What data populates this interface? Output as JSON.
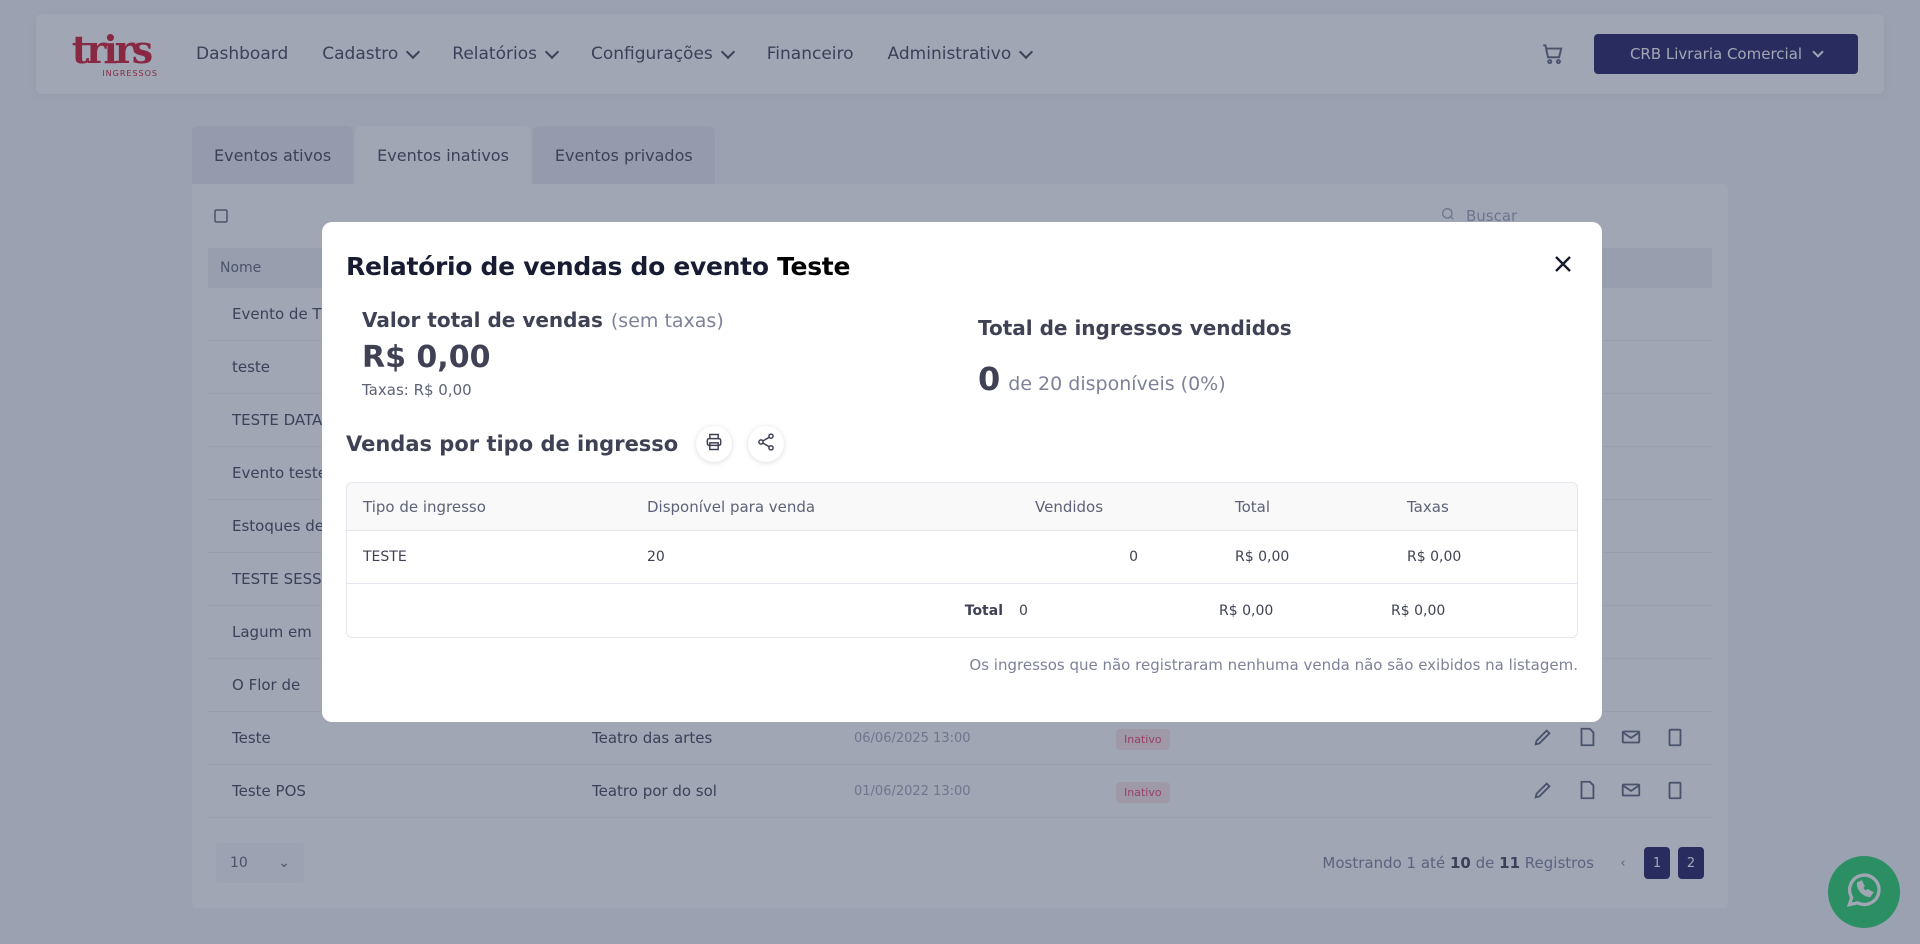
{
  "header": {
    "logo_main": "trirs",
    "logo_sub": "INGRESSOS",
    "nav": [
      {
        "label": "Dashboard",
        "dropdown": false
      },
      {
        "label": "Cadastro",
        "dropdown": true
      },
      {
        "label": "Relatórios",
        "dropdown": true
      },
      {
        "label": "Configurações",
        "dropdown": true
      },
      {
        "label": "Financeiro",
        "dropdown": false
      },
      {
        "label": "Administrativo",
        "dropdown": true
      }
    ],
    "user_label": "CRB Livraria Comercial"
  },
  "tabs": [
    "Eventos ativos",
    "Eventos inativos",
    "Eventos privados"
  ],
  "list": {
    "search_placeholder": "Buscar",
    "column_name": "Nome",
    "rows": [
      {
        "name": "Evento de T",
        "venue": "",
        "date": "",
        "status": ""
      },
      {
        "name": "teste",
        "venue": "",
        "date": "",
        "status": ""
      },
      {
        "name": "TESTE DATAS",
        "venue": "",
        "date": "",
        "status": ""
      },
      {
        "name": "Evento teste",
        "venue": "",
        "date": "",
        "status": ""
      },
      {
        "name": "Estoques de",
        "venue": "",
        "date": "",
        "status": ""
      },
      {
        "name": "TESTE SESSÃO",
        "venue": "",
        "date": "",
        "status": ""
      },
      {
        "name": "Lagum em",
        "venue": "",
        "date": "",
        "status": ""
      },
      {
        "name": "O Flor de",
        "venue": "",
        "date": "",
        "status": ""
      },
      {
        "name": "Teste",
        "venue": "Teatro das artes",
        "date": "06/06/2025 13:00",
        "status": "Inativo"
      },
      {
        "name": "Teste POS",
        "venue": "Teatro por do sol",
        "date": "01/06/2022 13:00",
        "status": "Inativo"
      }
    ],
    "page_size": "10",
    "page_info_prefix": "Mostrando 1 até",
    "page_info_to": "10",
    "page_info_of": "de",
    "page_info_total": "11",
    "page_info_suffix": "Registros",
    "pages": [
      "‹",
      "1",
      "2"
    ]
  },
  "modal": {
    "title_prefix": "Relatório de vendas do evento",
    "event_name": "Teste",
    "total_sales_label": "Valor total de vendas",
    "total_sales_note": "(sem taxas)",
    "total_sales_value": "R$ 0,00",
    "fees_label": "Taxas: R$ 0,00",
    "tickets_sold_label": "Total de ingressos vendidos",
    "tickets_sold_value": "0",
    "tickets_available_text": "de 20 disponíveis (0%)",
    "section_title": "Vendas por tipo de ingresso",
    "table": {
      "headers": [
        "Tipo de ingresso",
        "Disponível para venda",
        "Vendidos",
        "Total",
        "Taxas"
      ],
      "rows": [
        {
          "type": "TESTE",
          "available": "20",
          "sold": "0",
          "total": "R$ 0,00",
          "fees": "R$ 0,00"
        }
      ],
      "footer": {
        "label": "Total",
        "sold": "0",
        "total": "R$ 0,00",
        "fees": "R$ 0,00"
      }
    },
    "note": "Os ingressos que não registraram nenhuma venda não são exibidos na listagem."
  },
  "colors": {
    "brand_red": "#d3122a",
    "primary_navy": "#1e1a5f",
    "whatsapp_green": "#25d366"
  }
}
